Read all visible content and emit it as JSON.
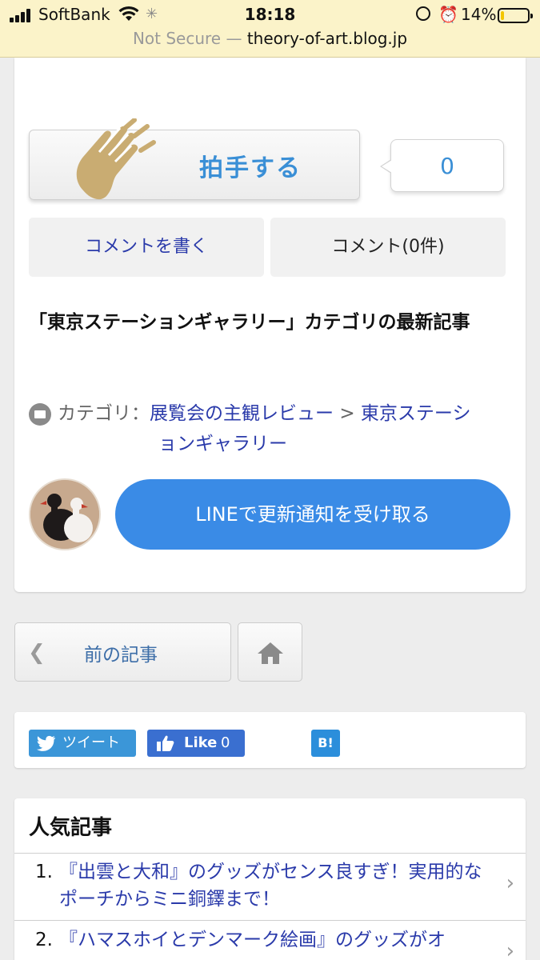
{
  "status_bar": {
    "carrier": "SoftBank",
    "time": "18:18",
    "battery_percent": "14%",
    "battery_level": 0.14,
    "url_security": "Not Secure —",
    "url_host": "theory-of-art.blog.jp"
  },
  "clap": {
    "label": "拍手する",
    "count": "0"
  },
  "comments": {
    "write_label": "コメントを書く",
    "count_label": "コメント(0件)"
  },
  "latest_heading": "「東京ステーションギャラリー」カテゴリの最新記事",
  "category": {
    "label": "カテゴリ：",
    "parent": "展覧会の主観レビュー",
    "separator": ">",
    "child_part1": "東京ステーシ",
    "child_part2": "ョンギャラリー"
  },
  "line_button": "LINEで更新通知を受け取る",
  "nav": {
    "prev_label": "前の記事"
  },
  "share": {
    "tweet_label": "ツイート",
    "fb_like_label": "Like",
    "fb_like_count": "0",
    "hatena_label": "B!"
  },
  "popular": {
    "heading": "人気記事",
    "items": [
      {
        "num": "1.",
        "title": "『出雲と大和』のグッズがセンス良すぎ！実用的なポーチからミニ銅鐸まで！"
      },
      {
        "num": "2.",
        "title": "『ハマスホイとデンマーク絵画』のグッズがオ"
      }
    ]
  },
  "colors": {
    "accent_blue": "#3a8fd6",
    "link_blue": "#2a3aaa",
    "line_button": "#3a8be6",
    "status_bg": "#fbf3c9"
  }
}
